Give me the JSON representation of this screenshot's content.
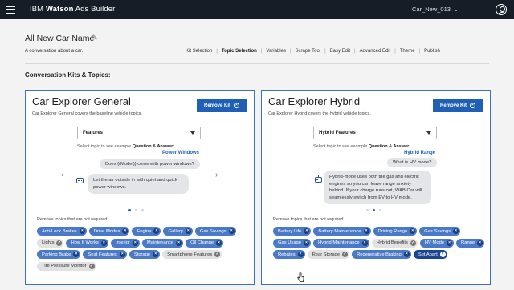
{
  "app": {
    "brand_prefix": "IBM",
    "brand_name": "Watson",
    "brand_suffix": "Ads Builder",
    "selected_car": "Car_New_013",
    "menu_icon": "hamburger-icon",
    "user_icon": "user-avatar-icon"
  },
  "page": {
    "title": "All New Car Name",
    "subtitle": "A conversation about a car.",
    "section_title": "Conversation Kits & Topics:"
  },
  "nav": [
    {
      "label": "Kit Selection",
      "active": false
    },
    {
      "label": "Topic Selection",
      "active": true
    },
    {
      "label": "Variables",
      "active": false
    },
    {
      "label": "Scrape Tool",
      "active": false
    },
    {
      "label": "Easy Edit",
      "active": false
    },
    {
      "label": "Advanced Edit",
      "active": false
    },
    {
      "label": "Theme",
      "active": false
    },
    {
      "label": "Publish",
      "active": false
    }
  ],
  "kits": [
    {
      "title": "Car Explorer General",
      "description": "Car Explorer General covers the baseline vehicle topics.",
      "remove_label": "Remove Kit",
      "dropdown": "Features",
      "prompt_plain": "Select topic to see example",
      "prompt_bold": "Question & Answer:",
      "topic": "Power Windows",
      "question": "Does {(Model)} come with power windows?",
      "answer": "Let the air outside in with quiet and quick power windows.",
      "remove_topics_label": "Remove topics that are not required.",
      "topics": [
        {
          "label": "Anti-Lock Brakes",
          "on": true
        },
        {
          "label": "Drive Modes",
          "on": true
        },
        {
          "label": "Engine",
          "on": true
        },
        {
          "label": "Gallery",
          "on": true
        },
        {
          "label": "Gas Savings",
          "on": true
        },
        {
          "label": "Lights",
          "on": false
        },
        {
          "label": "How It Works",
          "on": true
        },
        {
          "label": "Interior",
          "on": true
        },
        {
          "label": "Maintenance",
          "on": true
        },
        {
          "label": "Oil Change",
          "on": true
        },
        {
          "label": "Parking Brake",
          "on": true
        },
        {
          "label": "Seat Features",
          "on": true
        },
        {
          "label": "Storage",
          "on": true
        },
        {
          "label": "Smartphone Features",
          "on": false
        },
        {
          "label": "Tire Pressure Monitor",
          "on": false
        }
      ]
    },
    {
      "title": "Car Explorer Hybrid",
      "description": "Car Explorer Hybrid covers the hybrid vehicle topics.",
      "remove_label": "Remove Kit",
      "dropdown": "Hybrid Features",
      "prompt_plain": "Select topic to see example",
      "prompt_bold": "Question & Answer:",
      "topic": "Hybrid Range",
      "question": "What is HV mode?",
      "answer": "Hybrid-mode uses both the gas and electric engines so you can leave range anxiety behind. If your charge runs out, WAB Car will seamlessly switch from EV to HV mode.",
      "remove_topics_label": "Remove topics that are not required.",
      "topics": [
        {
          "label": "Battery Life",
          "on": true
        },
        {
          "label": "Battery Maintenance",
          "on": true
        },
        {
          "label": "Driving Range",
          "on": true
        },
        {
          "label": "Gas Savings",
          "on": true
        },
        {
          "label": "Gas Usage",
          "on": true
        },
        {
          "label": "Hybrid Maintenance",
          "on": true
        },
        {
          "label": "Hybrid Benefits",
          "on": false
        },
        {
          "label": "HV Mode",
          "on": true
        },
        {
          "label": "Range",
          "on": true
        },
        {
          "label": "Rebates",
          "on": true
        },
        {
          "label": "Rear Storage",
          "on": false
        },
        {
          "label": "Regenerative Braking",
          "on": true
        },
        {
          "label": "Set Apart",
          "on": true,
          "hovered": true
        }
      ]
    }
  ],
  "colors": {
    "topbar": "#161d27",
    "accent": "#1f5fb5",
    "chip_on": "#4a7ac7",
    "chip_off": "#e2e2e2"
  }
}
